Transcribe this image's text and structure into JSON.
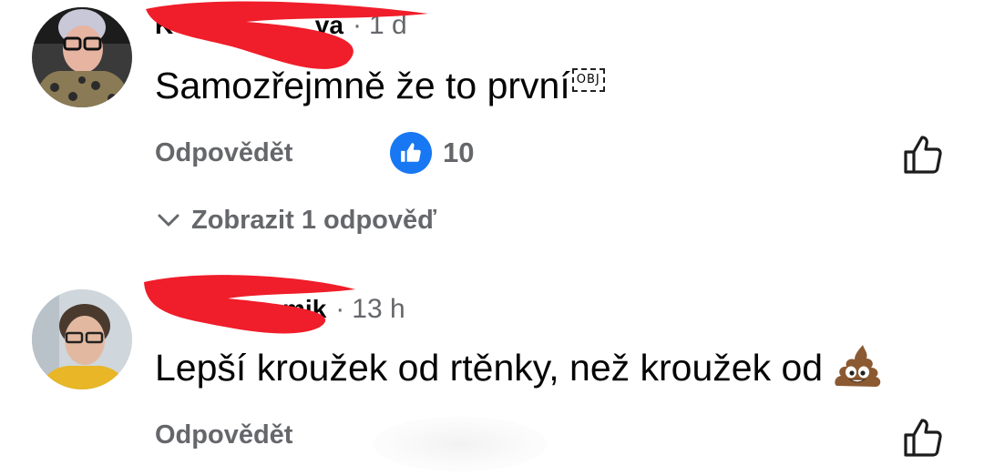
{
  "comments": [
    {
      "author": "K                    va",
      "time": "1 d",
      "text": "Samozřejmně že to první",
      "object_placeholder": "OBJ",
      "reply_label": "Odpovědět",
      "reaction_count": "10",
      "show_replies": "Zobrazit 1 odpověď"
    },
    {
      "author": "                  mik",
      "time": "13 h",
      "text": "Lepší kroužek od rtěnky, než kroužek od",
      "emoji": "pile-of-poo",
      "reply_label": "Odpovědět"
    }
  ],
  "separator": "·",
  "colors": {
    "secondary_text": "#65676b",
    "like_blue": "#1877f2",
    "redaction": "#f01d2a"
  }
}
